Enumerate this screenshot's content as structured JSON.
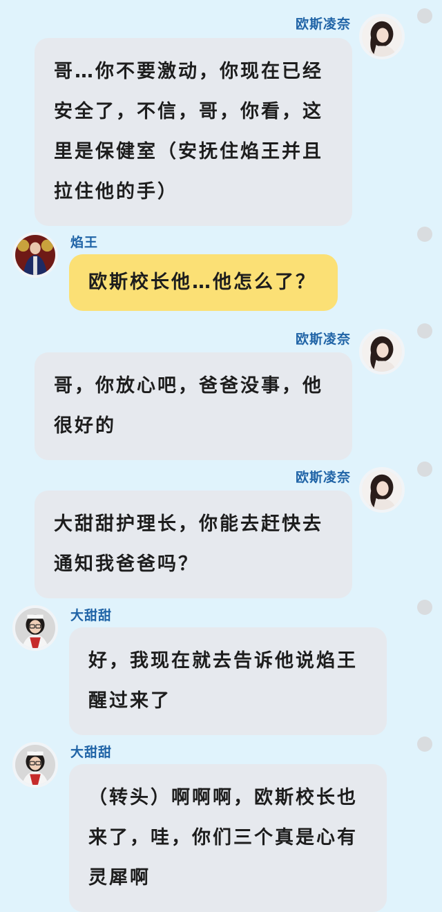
{
  "messages": [
    {
      "speaker": "欧斯凌奈",
      "text": "哥…你不要激动，你现在已经安全了，不信，哥，你看，这里是保健室（安抚住焰王并且拉住他的手）"
    },
    {
      "speaker": "焰王",
      "text": "欧斯校长他…他怎么了？"
    },
    {
      "speaker": "欧斯凌奈",
      "text": "哥，你放心吧，爸爸没事，他很好的"
    },
    {
      "speaker": "欧斯凌奈",
      "text": "大甜甜护理长，你能去赶快去通知我爸爸吗？"
    },
    {
      "speaker": "大甜甜",
      "text": "好，我现在就去告诉他说焰王醒过来了"
    },
    {
      "speaker": "大甜甜",
      "text": "（转头）啊啊啊，欧斯校长也来了，哇，你们三个真是心有灵犀啊"
    }
  ],
  "colors": {
    "background": "#e0f3fc",
    "bubble_gray": "#e6e9ee",
    "bubble_yellow": "#fbe075",
    "name_blue": "#1f63a6"
  },
  "icons": [
    "avatar-ousi-lingnai",
    "avatar-yanwang",
    "avatar-datiantian",
    "more-dot-icon"
  ]
}
